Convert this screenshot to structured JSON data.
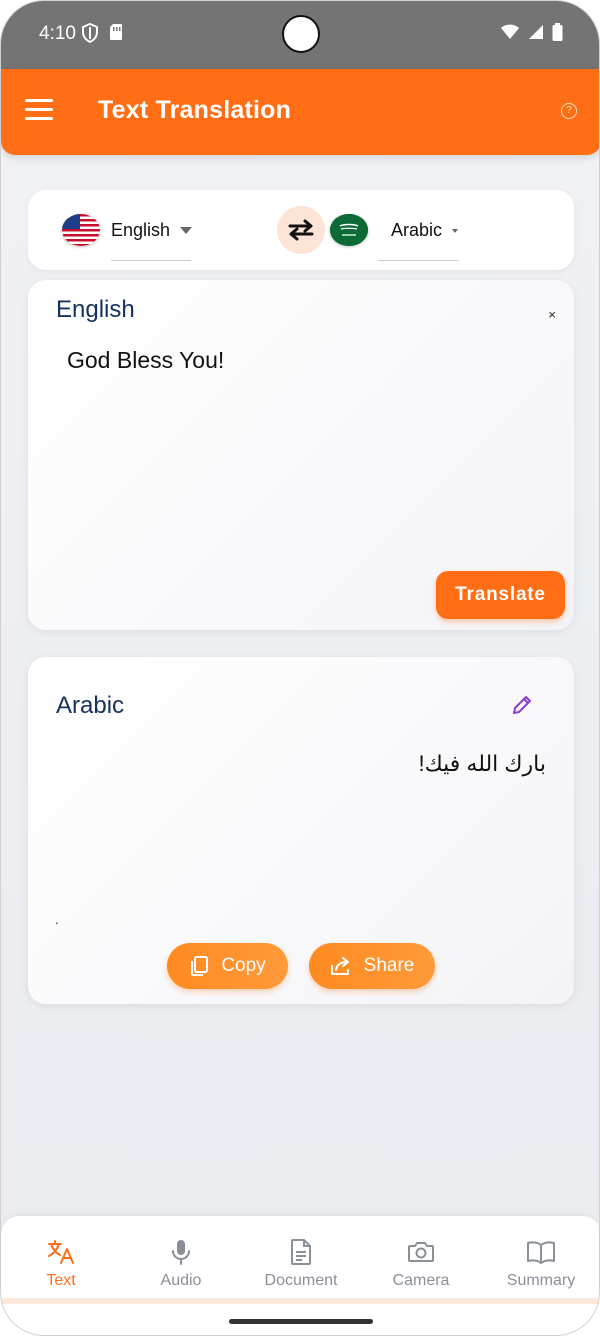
{
  "status_bar": {
    "time": "4:10"
  },
  "app_bar": {
    "title": "Text Translation"
  },
  "language_selector": {
    "from_language": "English",
    "to_language": "Arabic"
  },
  "source": {
    "language_label": "English",
    "text": "God Bless You!",
    "clear_label": "×",
    "translate_label": "Translate"
  },
  "result": {
    "language_label": "Arabic",
    "text": "بارك الله فيك!",
    "dot": ".",
    "copy_label": "Copy",
    "share_label": "Share"
  },
  "bottom_nav": {
    "items": [
      {
        "label": "Text",
        "icon": "translate-icon",
        "active": true
      },
      {
        "label": "Audio",
        "icon": "mic-icon",
        "active": false
      },
      {
        "label": "Document",
        "icon": "document-icon",
        "active": false
      },
      {
        "label": "Camera",
        "icon": "camera-icon",
        "active": false
      },
      {
        "label": "Summary",
        "icon": "book-icon",
        "active": false
      }
    ]
  },
  "colors": {
    "accent": "#ff6e14",
    "label_blue": "#15325c",
    "nav_inactive": "#8a8f98"
  }
}
